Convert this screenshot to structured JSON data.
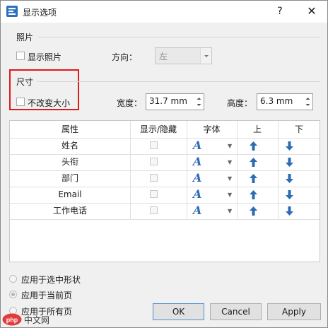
{
  "window": {
    "title": "显示选项",
    "help_glyph": "?",
    "close_glyph": "✕"
  },
  "photo": {
    "section_label": "照片",
    "show_photo_label": "显示照片",
    "direction_label": "方向：",
    "direction_value": "左"
  },
  "size": {
    "section_label": "尺寸",
    "keep_size_label": "不改变大小",
    "width_label": "宽度：",
    "width_value": "31.7 mm",
    "height_label": "高度：",
    "height_value": "6.3 mm"
  },
  "table": {
    "columns": [
      "属性",
      "显示/隐藏",
      "字体",
      "上",
      "下"
    ],
    "rows": [
      {
        "name": "姓名",
        "font_glyph": "A"
      },
      {
        "name": "头衔",
        "font_glyph": "A"
      },
      {
        "name": "部门",
        "font_glyph": "A"
      },
      {
        "name": "Email",
        "font_glyph": "A"
      },
      {
        "name": "工作电话",
        "font_glyph": "A"
      }
    ]
  },
  "apply_scope": {
    "options": [
      "应用于选中形状",
      "应用于当前页",
      "应用于所有页"
    ],
    "selected_index": 1
  },
  "buttons": {
    "ok": "OK",
    "cancel": "Cancel",
    "apply": "Apply"
  },
  "watermark": {
    "text": "中文网",
    "logo_glyph": "php"
  },
  "icons": {
    "app": "edraw-app-icon",
    "up": "up-arrow-icon",
    "down": "down-arrow-icon",
    "font": "font-style-icon"
  },
  "colors": {
    "accent": "#2d6bb3",
    "highlight_border": "#e0191a"
  }
}
